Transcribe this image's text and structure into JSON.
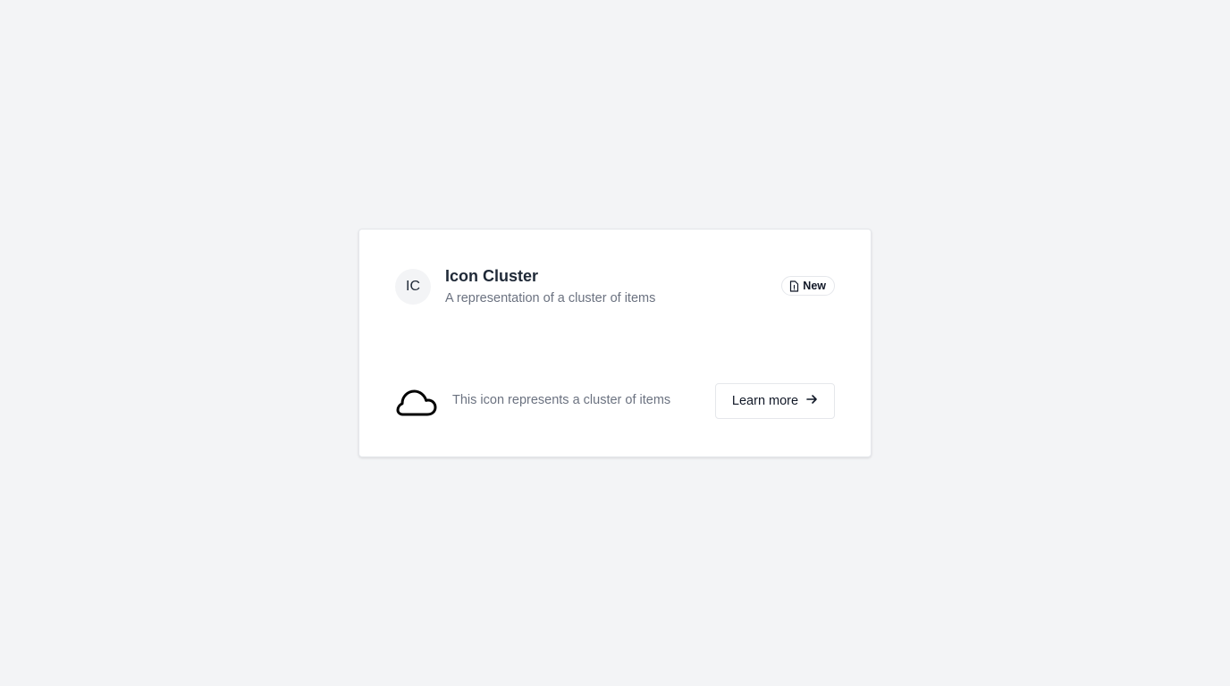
{
  "card": {
    "avatar_initials": "IC",
    "title": "Icon Cluster",
    "subtitle": "A representation of a cluster of items",
    "badge": {
      "label": "New",
      "icon": "document-icon"
    },
    "footer": {
      "icon": "cloud-icon",
      "description": "This icon represents a cluster of items",
      "button_label": "Learn more",
      "button_icon": "arrow-right-icon"
    }
  },
  "colors": {
    "page_background": "#f3f4f6",
    "card_background": "#ffffff",
    "title": "#1f2937",
    "muted_text": "#6b7280",
    "border": "#e5e7eb"
  }
}
